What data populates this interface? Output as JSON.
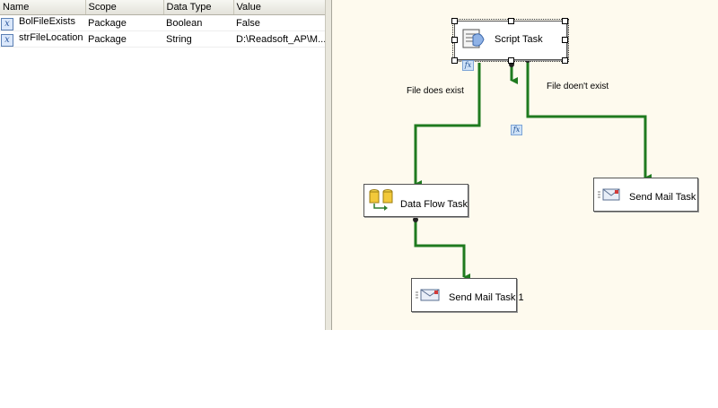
{
  "variables": {
    "columns": [
      "Name",
      "Scope",
      "Data Type",
      "Value"
    ],
    "rows": [
      [
        "BolFileExists",
        "Package",
        "Boolean",
        "False"
      ],
      [
        "strFileLocation",
        "Package",
        "String",
        "D:\\Readsoft_AP\\M..."
      ]
    ],
    "row_icon": "variable-x-icon"
  },
  "canvas": {
    "tasks": {
      "script": "Script Task",
      "dataflow": "Data Flow Task",
      "sendmail": "Send Mail Task",
      "sendmail1": "Send Mail Task 1"
    },
    "labels": {
      "exists": "File does exist",
      "not_exists": "File doen't exist"
    },
    "expression_badge": "fx",
    "colors": {
      "success_connector": "#1f7a1f",
      "background": "#fefaee"
    }
  }
}
